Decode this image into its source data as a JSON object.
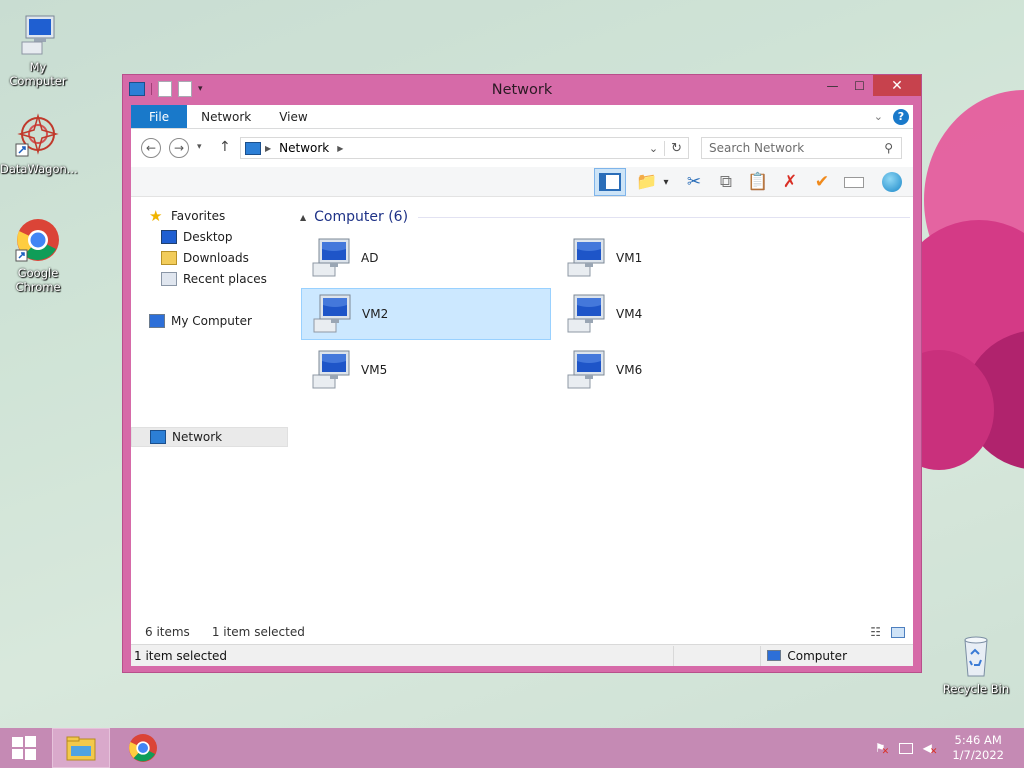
{
  "desktop": {
    "icons": [
      {
        "label": "My Computer",
        "icon": "my-computer-icon"
      },
      {
        "label": "DataWagon...",
        "icon": "datawagon-icon"
      },
      {
        "label": "Google Chrome",
        "icon": "chrome-icon"
      },
      {
        "label": "Recycle Bin",
        "icon": "recycle-bin-icon"
      }
    ]
  },
  "window": {
    "title": "Network",
    "ribbon_tabs": [
      "File",
      "Network",
      "View"
    ],
    "address": {
      "crumb": "Network"
    },
    "search": {
      "placeholder": "Search Network"
    },
    "nav": {
      "favorites": "Favorites",
      "desktop": "Desktop",
      "downloads": "Downloads",
      "recent": "Recent places",
      "my_computer": "My Computer",
      "network": "Network"
    },
    "group": {
      "title": "Computer (6)"
    },
    "items": [
      "AD",
      "VM1",
      "VM2",
      "VM4",
      "VM5",
      "VM6"
    ],
    "selected_item": "VM2",
    "status": {
      "count": "6 items",
      "selected": "1 item selected",
      "details_selected": "1 item selected",
      "details_type": "Computer"
    }
  },
  "taskbar": {
    "time": "5:46 AM",
    "date": "1/7/2022"
  },
  "colors": {
    "window_frame": "#d66aa8",
    "accent": "#1979ca",
    "taskbar": "#c58ab4",
    "selection": "#cce8ff",
    "close_button": "#c7424d"
  }
}
